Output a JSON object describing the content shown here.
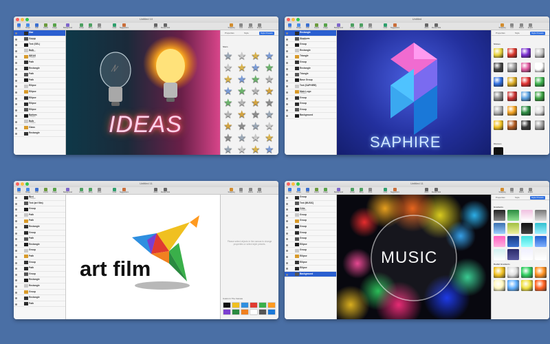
{
  "toolbar": [
    "Tool",
    "Shape",
    "Path",
    "Import",
    "Image",
    "Backgrounds",
    "Group",
    "Bring",
    "Front",
    "Color",
    "Suggestions",
    "Zoom",
    "Render Mode",
    "Snapping",
    "Grid",
    "Rulers",
    "Export"
  ],
  "windows": [
    {
      "title": "Untitled 10",
      "panel_tabs": [
        "Properties",
        "Style",
        "Style Presets"
      ],
      "panel_sections": [
        "Fill",
        "Stars"
      ],
      "layers": [
        {
          "name": "Star",
          "selected": true
        },
        {
          "name": "Group",
          "sub": "2 Shapes"
        },
        {
          "name": "Text (SEL)"
        },
        {
          "name": "Bulb",
          "sub": "2 Shapes"
        },
        {
          "name": "IDEAS",
          "sub": "4 Shapes"
        },
        {
          "name": "Path"
        },
        {
          "name": "Rectangle"
        },
        {
          "name": "Path"
        },
        {
          "name": "Path"
        },
        {
          "name": "Ellipse"
        },
        {
          "name": "Ellipse"
        },
        {
          "name": "Ellipse"
        },
        {
          "name": "Ellipse"
        },
        {
          "name": "Ellipse"
        },
        {
          "name": "Bottom",
          "sub": "2 Shapes"
        },
        {
          "name": "Bulb",
          "sub": "3 Shapes"
        },
        {
          "name": "Glass"
        },
        {
          "name": "Rectangle"
        }
      ],
      "artwork_text": "IDEAS"
    },
    {
      "title": "Untitled",
      "panel_tabs": [
        "Properties",
        "Style",
        "Style Presets"
      ],
      "panel_sections": [
        "Fill",
        "Shines",
        "Glasses"
      ],
      "layers": [
        {
          "name": "Rectangle",
          "selected": true
        },
        {
          "name": "Shadows",
          "sub": "2 Shapes"
        },
        {
          "name": "Group"
        },
        {
          "name": "Rectangle"
        },
        {
          "name": "Triangle"
        },
        {
          "name": "Group"
        },
        {
          "name": "Rectangle"
        },
        {
          "name": "Triangle"
        },
        {
          "name": "Base Group"
        },
        {
          "name": "Text (SAPHIRE)"
        },
        {
          "name": "Main Logo",
          "sub": "3 Shapes"
        },
        {
          "name": "Group"
        },
        {
          "name": "Group"
        },
        {
          "name": "Group"
        },
        {
          "name": "Background"
        }
      ],
      "artwork_text": "SAPHIRE"
    },
    {
      "title": "Untitled 11",
      "panel_tabs": [],
      "panel_sections": [
        "Colors In The Canvas"
      ],
      "panel_hint": "Please select objects in the canvas to change properties or select style presets.",
      "layers": [
        {
          "name": "Bird",
          "sub": "2 Shapes"
        },
        {
          "name": "Text (art film)"
        },
        {
          "name": "Group"
        },
        {
          "name": "Path"
        },
        {
          "name": "Path"
        },
        {
          "name": "Rectangle"
        },
        {
          "name": "Group"
        },
        {
          "name": "Path"
        },
        {
          "name": "Rectangle"
        },
        {
          "name": "Group"
        },
        {
          "name": "Path"
        },
        {
          "name": "Group"
        },
        {
          "name": "Path"
        },
        {
          "name": "Group"
        },
        {
          "name": "Rectangle"
        },
        {
          "name": "Rectangle"
        },
        {
          "name": "Group"
        },
        {
          "name": "Rectangle"
        },
        {
          "name": "Path"
        }
      ],
      "artwork_text": "art film"
    },
    {
      "title": "Untitled 11",
      "panel_tabs": [
        "Properties",
        "Style",
        "Style Presets"
      ],
      "panel_sections": [
        "Gradients",
        "Radial Gradients"
      ],
      "layers": [
        {
          "name": "Group"
        },
        {
          "name": "Text (MUSIC)"
        },
        {
          "name": "Orbs",
          "sub": "4 Shapes"
        },
        {
          "name": "Group"
        },
        {
          "name": "Group"
        },
        {
          "name": "Group"
        },
        {
          "name": "Group"
        },
        {
          "name": "Group"
        },
        {
          "name": "Ellipse"
        },
        {
          "name": "Group"
        },
        {
          "name": "Ellipse"
        },
        {
          "name": "Ellipse"
        },
        {
          "name": "Ellipse"
        },
        {
          "name": "Background",
          "selected": true
        }
      ],
      "artwork_text": "MUSIC"
    }
  ],
  "colors": {
    "desktop": "#4a6fa5",
    "selection": "#2a5fd0",
    "ideas_bg_left": "#0d3a4a",
    "ideas_bg_right": "#d8458a",
    "saphire_bg": "#1f2f9a",
    "music_bg": "#0a0a14"
  }
}
